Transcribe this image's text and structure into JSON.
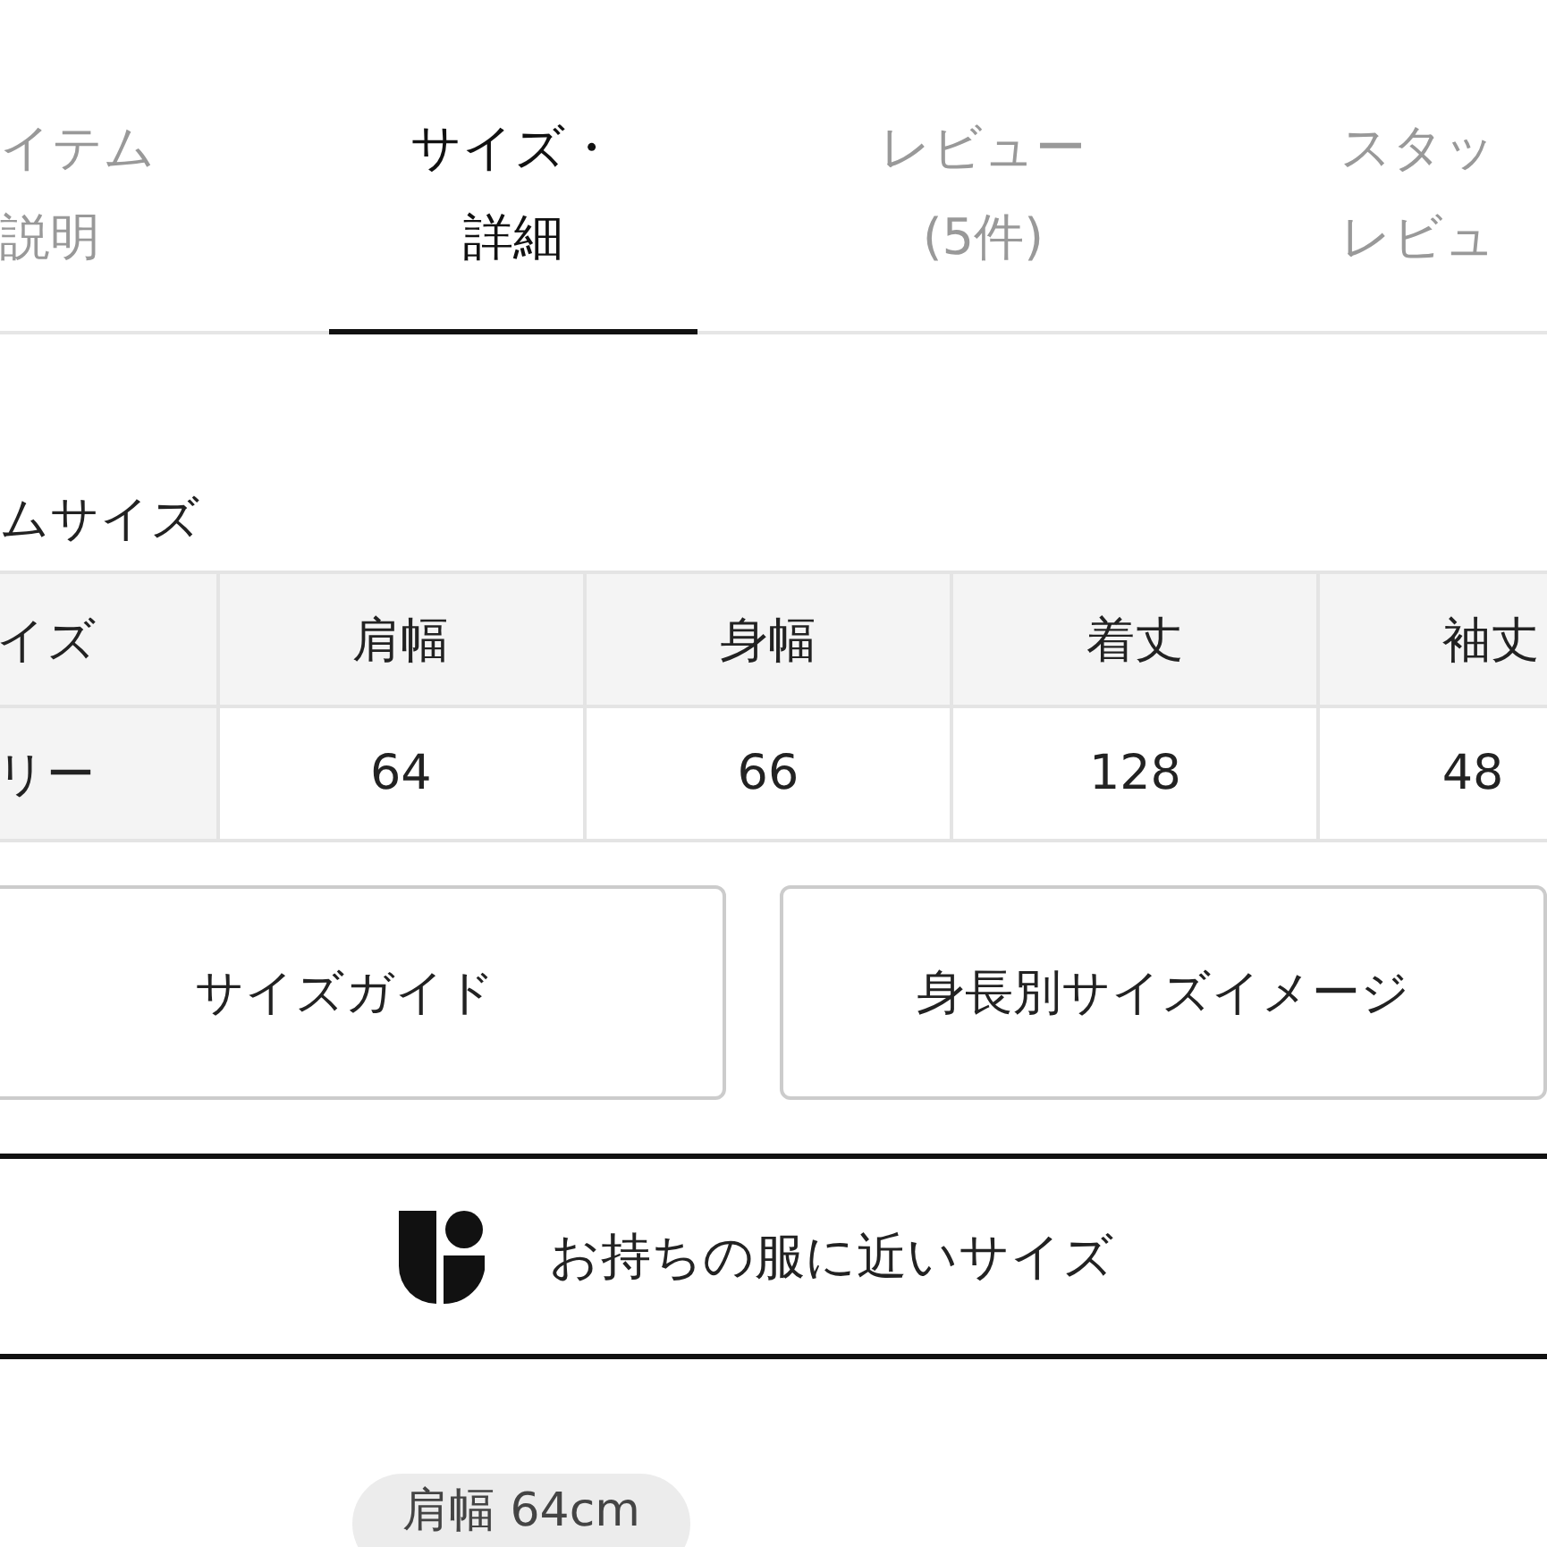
{
  "tabs": [
    {
      "lines": [
        "イテム",
        "説明"
      ],
      "selected": false
    },
    {
      "lines": [
        "サイズ・",
        "詳細"
      ],
      "selected": true
    },
    {
      "lines": [
        "レビュー",
        "(5件)"
      ],
      "selected": false
    },
    {
      "lines": [
        "スタッ",
        "レビュ"
      ],
      "selected": false
    }
  ],
  "size_section": {
    "title": "ムサイズ",
    "table": {
      "columns": [
        "イズ",
        "肩幅",
        "身幅",
        "着丈",
        "袖丈"
      ],
      "rows": [
        [
          "リー",
          "64",
          "66",
          "128",
          "48"
        ]
      ]
    }
  },
  "buttons": [
    "サイズガイド",
    "身長別サイズイメージ"
  ],
  "similar_size_button": {
    "label": "お持ちの服に近いサイズ"
  },
  "measurement_chips": [
    "肩幅 64cm"
  ]
}
